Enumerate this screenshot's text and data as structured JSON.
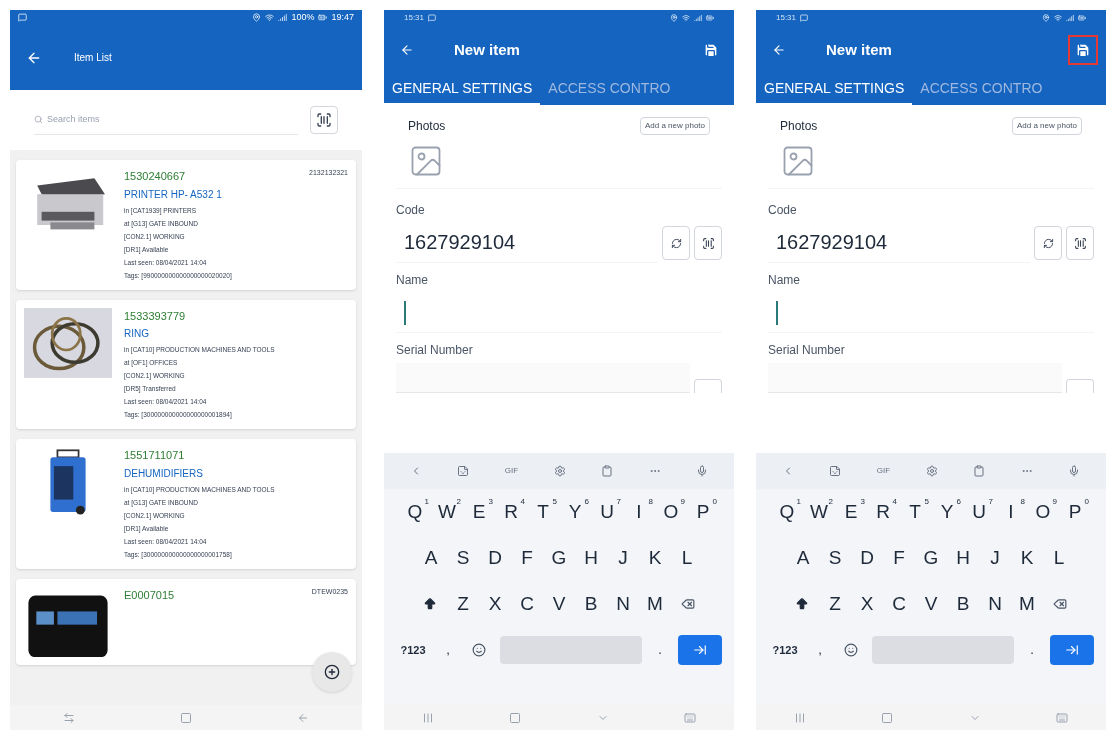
{
  "item_list_screen": {
    "status_bar": {
      "battery": "100%",
      "time": "19:47"
    },
    "app_bar": {
      "title": "Item List"
    },
    "search": {
      "placeholder": "Search items"
    },
    "items": [
      {
        "code": "1530240667",
        "reference": "2132132321",
        "name": "PRINTER HP- A532 1",
        "details": [
          "in [CAT1939] PRINTERS",
          "at [G13] GATE INBOUND",
          "[CON2.1] WORKING",
          "[DR1] Available",
          "Last seen: 08/04/2021 14:04",
          "Tags: [990000000000000000020020]"
        ]
      },
      {
        "code": "1533393779",
        "name": "RING",
        "details": [
          "in [CAT10] PRODUCTION MACHINES AND TOOLS",
          "at [OF1] OFFICES",
          "[CON2.1] WORKING",
          "[DR5] Transferred",
          "Last seen: 08/04/2021 14:04",
          "Tags: [300000000000000000001894]"
        ]
      },
      {
        "code": "1551711071",
        "name": "DEHUMIDIFIERS",
        "details": [
          "in [CAT10] PRODUCTION MACHINES AND TOOLS",
          "at [G13] GATE INBOUND",
          "[CON2.1] WORKING",
          "[DR1] Available",
          "Last seen: 08/04/2021 14:04",
          "Tags: [300000000000000000001758]"
        ]
      },
      {
        "code": "E0007015",
        "reference": "DTEW0235"
      }
    ]
  },
  "new_item_screens": [
    {
      "status_bar": {
        "time": "15:31"
      },
      "app_bar": {
        "title": "New item",
        "save_highlighted": false
      },
      "tabs": [
        {
          "label": "GENERAL SETTINGS",
          "selected": true
        },
        {
          "label": "ACCESS CONTRO",
          "selected": false
        }
      ],
      "photos": {
        "label": "Photos",
        "button": "Add a new photo"
      },
      "fields": [
        {
          "label": "Code",
          "value": "1627929104",
          "kind": "code"
        },
        {
          "label": "Name",
          "kind": "text",
          "focused": true
        },
        {
          "label": "Serial Number",
          "kind": "scan"
        }
      ],
      "keyboard": {
        "toolbar_label": "GIF",
        "rows": [
          [
            {
              "key": "Q",
              "hint": "1"
            },
            {
              "key": "W",
              "hint": "2"
            },
            {
              "key": "E",
              "hint": "3"
            },
            {
              "key": "R",
              "hint": "4"
            },
            {
              "key": "T",
              "hint": "5"
            },
            {
              "key": "Y",
              "hint": "6"
            },
            {
              "key": "U",
              "hint": "7"
            },
            {
              "key": "I",
              "hint": "8"
            },
            {
              "key": "O",
              "hint": "9"
            },
            {
              "key": "P",
              "hint": "0"
            }
          ],
          [
            {
              "key": "A"
            },
            {
              "key": "S"
            },
            {
              "key": "D"
            },
            {
              "key": "F"
            },
            {
              "key": "G"
            },
            {
              "key": "H"
            },
            {
              "key": "J"
            },
            {
              "key": "K"
            },
            {
              "key": "L"
            }
          ],
          [
            {
              "key": "Z"
            },
            {
              "key": "X"
            },
            {
              "key": "C"
            },
            {
              "key": "V"
            },
            {
              "key": "B"
            },
            {
              "key": "N"
            },
            {
              "key": "M"
            }
          ]
        ],
        "symbols": "?123",
        "comma": ",",
        "period": "."
      }
    },
    {
      "status_bar": {
        "time": "15:31"
      },
      "app_bar": {
        "title": "New item",
        "save_highlighted": true
      },
      "tabs": [
        {
          "label": "GENERAL SETTINGS",
          "selected": true
        },
        {
          "label": "ACCESS CONTRO",
          "selected": false
        }
      ],
      "photos": {
        "label": "Photos",
        "button": "Add a new photo"
      },
      "fields": [
        {
          "label": "Code",
          "value": "1627929104",
          "kind": "code"
        },
        {
          "label": "Name",
          "kind": "text",
          "focused": true
        },
        {
          "label": "Serial Number",
          "kind": "scan"
        }
      ],
      "keyboard": {
        "toolbar_label": "GIF",
        "rows": [
          [
            {
              "key": "Q",
              "hint": "1"
            },
            {
              "key": "W",
              "hint": "2"
            },
            {
              "key": "E",
              "hint": "3"
            },
            {
              "key": "R",
              "hint": "4"
            },
            {
              "key": "T",
              "hint": "5"
            },
            {
              "key": "Y",
              "hint": "6"
            },
            {
              "key": "U",
              "hint": "7"
            },
            {
              "key": "I",
              "hint": "8"
            },
            {
              "key": "O",
              "hint": "9"
            },
            {
              "key": "P",
              "hint": "0"
            }
          ],
          [
            {
              "key": "A"
            },
            {
              "key": "S"
            },
            {
              "key": "D"
            },
            {
              "key": "F"
            },
            {
              "key": "G"
            },
            {
              "key": "H"
            },
            {
              "key": "J"
            },
            {
              "key": "K"
            },
            {
              "key": "L"
            }
          ],
          [
            {
              "key": "Z"
            },
            {
              "key": "X"
            },
            {
              "key": "C"
            },
            {
              "key": "V"
            },
            {
              "key": "B"
            },
            {
              "key": "N"
            },
            {
              "key": "M"
            }
          ]
        ],
        "symbols": "?123",
        "comma": ",",
        "period": "."
      }
    }
  ]
}
